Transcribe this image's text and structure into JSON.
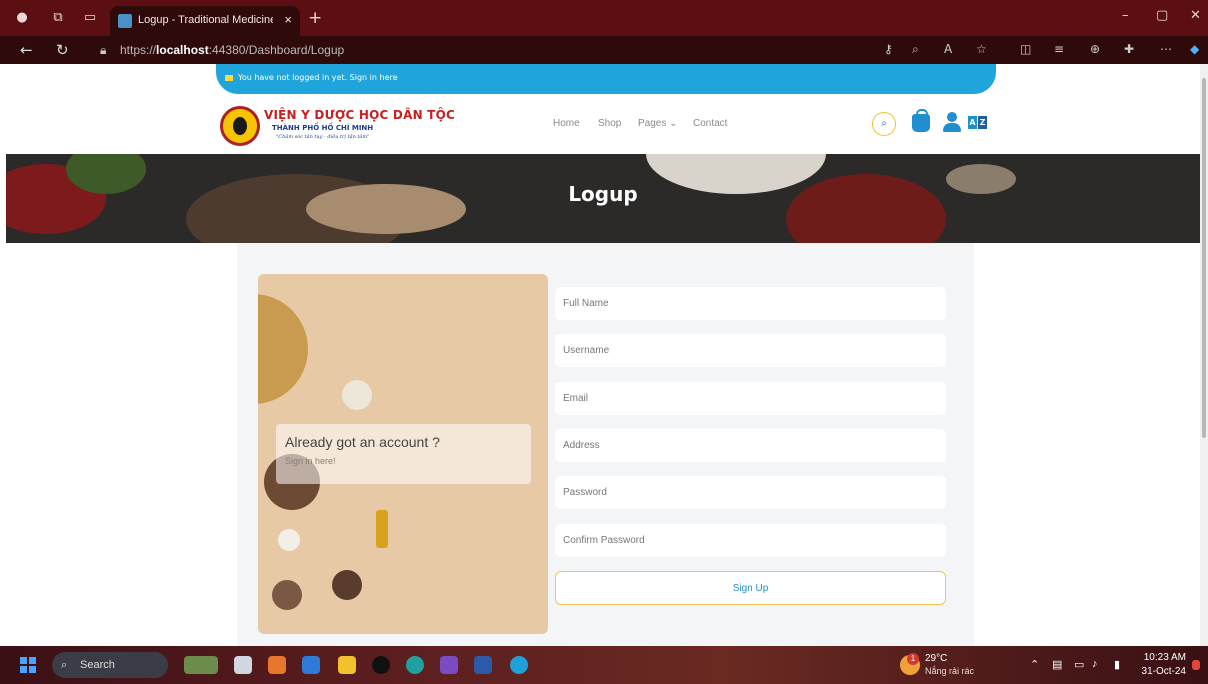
{
  "browser": {
    "tab_title": "Logup - Traditional Medicine Hos",
    "tab_close": "×",
    "new_tab": "+",
    "url_prefix": "https://",
    "url_host": "localhost",
    "url_rest": ":44380/Dashboard/Logup",
    "win_minimize": "–",
    "win_restore": "▢",
    "win_close": "✕"
  },
  "notice": {
    "text": "You have not logged in yet. Sign in here"
  },
  "logo": {
    "line1": "VIỆN Y DƯỢC HỌC DÂN TỘC",
    "line2": "THÀNH PHỐ HỒ CHÍ MINH",
    "line3": "\"Chăm sóc tận tụy - điều trị tận tâm\""
  },
  "nav": {
    "home": "Home",
    "shop": "Shop",
    "pages": "Pages ⌄",
    "contact": "Contact"
  },
  "lang_badge": {
    "a": "A",
    "b": "Z"
  },
  "hero": {
    "title": "Logup"
  },
  "card": {
    "heading": "Already got an account ?",
    "link": "Sign in here!"
  },
  "form": {
    "full_name": "Full Name",
    "username": "Username",
    "email": "Email",
    "address": "Address",
    "password": "Password",
    "confirm_password": "Confirm Password",
    "submit": "Sign Up"
  },
  "taskbar": {
    "search": "Search",
    "weather_temp": "29°C",
    "weather_desc": "Nắng rải rác",
    "weather_badge": "1",
    "time": "10:23 AM",
    "date": "31-Oct-24"
  },
  "colors": {
    "accent_blue": "#1fa5dc",
    "icon_blue": "#1f8fd0",
    "button_border": "#f1c74f",
    "browser_frame": "#5b0f12"
  }
}
